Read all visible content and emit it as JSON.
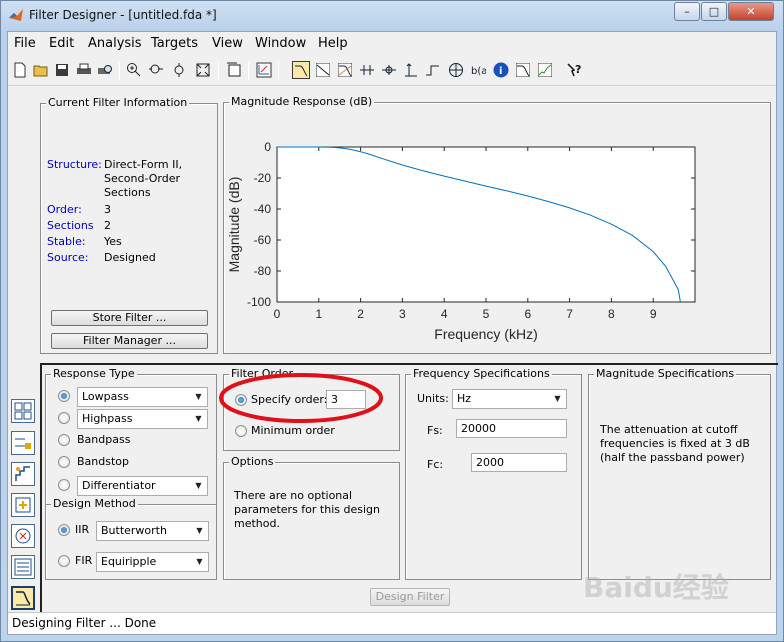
{
  "window": {
    "title": "Filter Designer - [untitled.fda *]",
    "min_glyph": "–",
    "max_glyph": "□",
    "close_glyph": "✕"
  },
  "menu": [
    "File",
    "Edit",
    "Analysis",
    "Targets",
    "View",
    "Window",
    "Help"
  ],
  "current_filter": {
    "title": "Current Filter Information",
    "structure_label": "Structure:",
    "structure_value": [
      "Direct-Form II,",
      "Second-Order",
      "Sections"
    ],
    "order_label": "Order:",
    "order_value": "3",
    "sections_label": "Sections",
    "sections_value": "2",
    "stable_label": "Stable:",
    "stable_value": "Yes",
    "source_label": "Source:",
    "source_value": "Designed",
    "store_button": "Store Filter ...",
    "manager_button": "Filter Manager ..."
  },
  "magnitude_panel": {
    "title": "Magnitude Response (dB)"
  },
  "chart_data": {
    "type": "line",
    "title": "",
    "xlabel": "Frequency (kHz)",
    "ylabel": "Magnitude (dB)",
    "xlim": [
      0,
      10
    ],
    "ylim": [
      -100,
      0
    ],
    "x_ticks": [
      0,
      1,
      2,
      3,
      4,
      5,
      6,
      7,
      8,
      9
    ],
    "y_ticks": [
      0,
      -20,
      -40,
      -60,
      -80,
      -100
    ],
    "grid": false,
    "series": [
      {
        "color": "#0072bd",
        "x": [
          0,
          0.5,
          1,
          1.3,
          1.5,
          1.7,
          1.85,
          2,
          2.2,
          2.5,
          3,
          3.5,
          4,
          4.5,
          5,
          5.5,
          6,
          6.5,
          7,
          7.5,
          8,
          8.5,
          9,
          9.3,
          9.6,
          9.65
        ],
        "y": [
          0,
          0,
          0,
          -0.2,
          -0.6,
          -1.3,
          -2.1,
          -3,
          -4.6,
          -7.3,
          -11.6,
          -15.4,
          -18.8,
          -22,
          -25.2,
          -28.3,
          -31.6,
          -35.2,
          -39.3,
          -44,
          -49.8,
          -57,
          -67.5,
          -77,
          -92,
          -100
        ]
      }
    ]
  },
  "response_type": {
    "title": "Response Type",
    "lowpass": "Lowpass",
    "highpass": "Highpass",
    "bandpass": "Bandpass",
    "bandstop": "Bandstop",
    "differentiator": "Differentiator"
  },
  "design_method": {
    "title": "Design Method",
    "iir": "IIR",
    "iir_value": "Butterworth",
    "fir": "FIR",
    "fir_value": "Equiripple"
  },
  "filter_order": {
    "title": "Filter Order",
    "specify": "Specify order:",
    "specify_value": "3",
    "minimum": "Minimum order"
  },
  "options": {
    "title": "Options",
    "text": [
      "There are no optional",
      "parameters for this design",
      "method."
    ]
  },
  "freq_spec": {
    "title": "Frequency Specifications",
    "units_label": "Units:",
    "units_value": "Hz",
    "fs_label": "Fs:",
    "fs_value": "20000",
    "fc_label": "Fc:",
    "fc_value": "2000"
  },
  "mag_spec": {
    "title": "Magnitude Specifications",
    "text": [
      "The attenuation at cutoff",
      "frequencies is fixed at 3 dB",
      "(half the passband power)"
    ]
  },
  "design_button": "Design Filter",
  "status": "Designing Filter ... Done",
  "watermark": "Baidu经验",
  "highlight_color": "#e0101a"
}
